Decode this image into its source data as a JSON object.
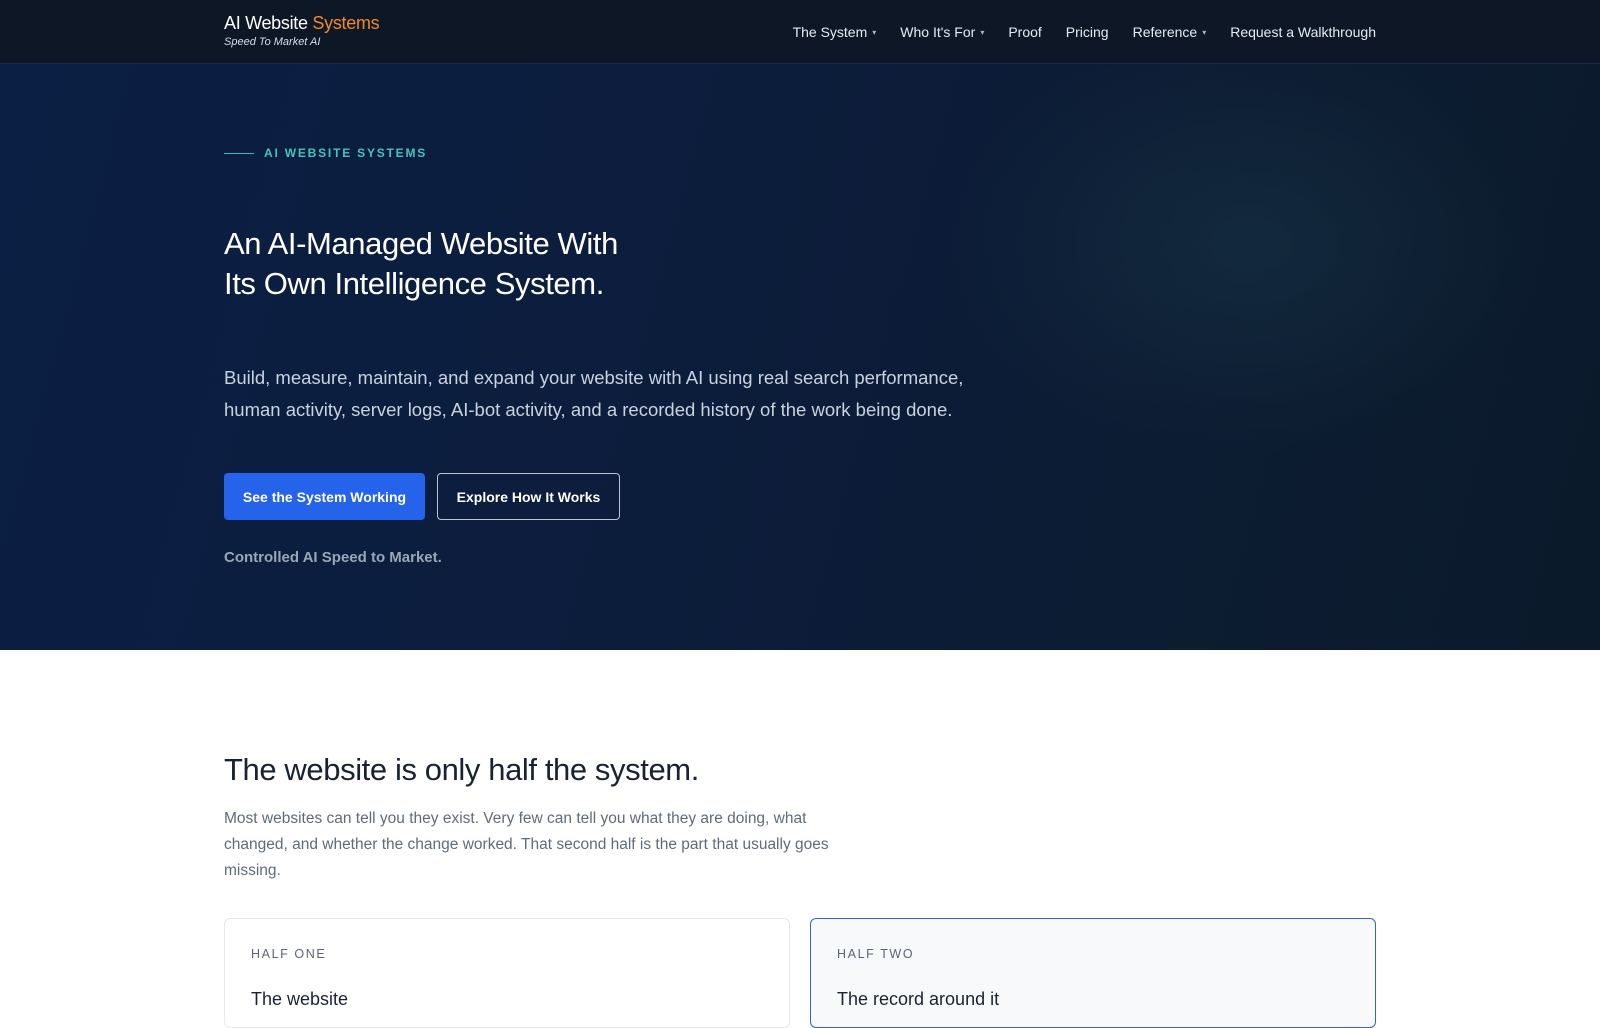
{
  "brand": {
    "name_main": "AI Website",
    "name_accent": "Systems",
    "tagline": "Speed To Market AI",
    "accent_color": "#f08a2c"
  },
  "nav": {
    "items": [
      {
        "label": "The System",
        "has_dropdown": true
      },
      {
        "label": "Who It's For",
        "has_dropdown": true
      },
      {
        "label": "Proof",
        "has_dropdown": false
      },
      {
        "label": "Pricing",
        "has_dropdown": false
      },
      {
        "label": "Reference",
        "has_dropdown": true
      },
      {
        "label": "Request a Walkthrough",
        "has_dropdown": false
      }
    ],
    "caret_glyph": "▾"
  },
  "hero": {
    "eyebrow": "AI WEBSITE SYSTEMS",
    "title": "An AI-Managed Website With Its Own Intelligence System.",
    "lead": "Build, measure, maintain, and expand your website with AI using real search performance, human activity, server logs, AI-bot activity, and a recorded history of the work being done.",
    "primary_cta": "See the System Working",
    "secondary_cta": "Explore How It Works",
    "note": "Controlled AI Speed to Market.",
    "primary_color": "#2563eb",
    "eyebrow_color": "#49c2b8"
  },
  "section": {
    "title": "The website is only half the system.",
    "lead": "Most websites can tell you they exist. Very few can tell you what they are doing, what changed, and whether the change worked. That second half is the part that usually goes missing.",
    "cards": [
      {
        "label": "HALF ONE",
        "heading": "The website"
      },
      {
        "label": "HALF TWO",
        "heading": "The record around it"
      }
    ]
  }
}
